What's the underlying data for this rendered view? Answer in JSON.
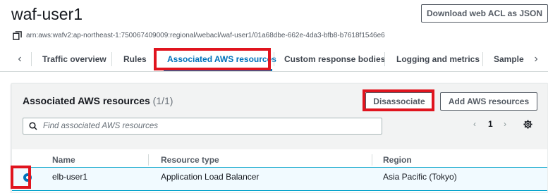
{
  "header": {
    "title": "waf-user1",
    "download_label": "Download web ACL as JSON",
    "arn": "arn:aws:wafv2:ap-northeast-1:750067409009:regional/webacl/waf-user1/01a68dbe-662e-4da3-bfb8-b7618f1546e6"
  },
  "tabs": {
    "items": [
      {
        "label": "Traffic overview"
      },
      {
        "label": "Rules"
      },
      {
        "label": "Associated AWS resources"
      },
      {
        "label": "Custom response bodies"
      },
      {
        "label": "Logging and metrics"
      },
      {
        "label": "Sampled"
      }
    ],
    "active_index": 2
  },
  "panel": {
    "title": "Associated AWS resources",
    "count": "(1/1)",
    "disassociate_label": "Disassociate",
    "add_label": "Add AWS resources",
    "search_placeholder": "Find associated AWS resources",
    "page": "1"
  },
  "table": {
    "headers": [
      "Name",
      "Resource type",
      "Region"
    ],
    "rows": [
      {
        "name": "elb-user1",
        "type": "Application Load Balancer",
        "region": "Asia Pacific (Tokyo)",
        "selected": true
      }
    ]
  },
  "colors": {
    "accent": "#0073bb",
    "highlight_box": "#e0141e",
    "selected_row": "#f1faff"
  },
  "icons": [
    "copy-icon",
    "chevron-left-icon",
    "chevron-right-icon",
    "search-icon",
    "settings-icon",
    "radio-selected-icon"
  ]
}
